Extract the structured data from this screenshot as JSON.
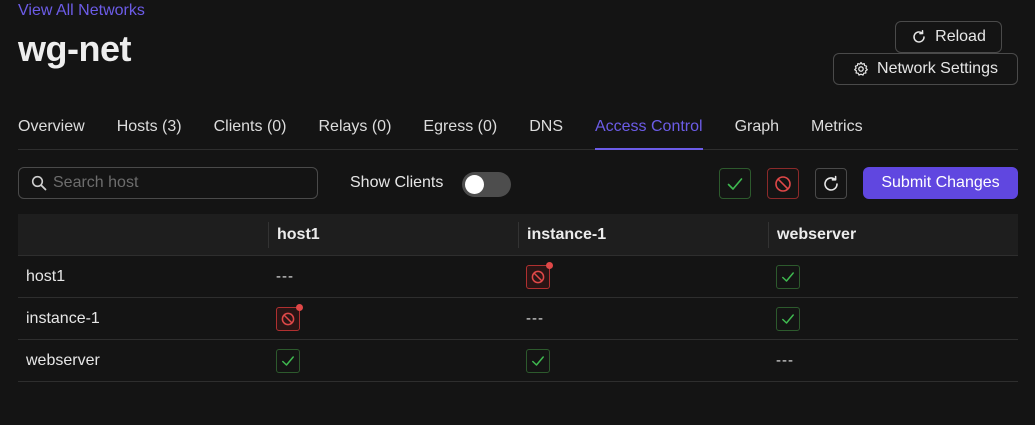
{
  "header": {
    "back_link": "View All Networks",
    "title": "wg-net",
    "reload_label": "Reload",
    "settings_label": "Network Settings"
  },
  "tabs": [
    {
      "label": "Overview"
    },
    {
      "label": "Hosts (3)"
    },
    {
      "label": "Clients (0)"
    },
    {
      "label": "Relays (0)"
    },
    {
      "label": "Egress (0)"
    },
    {
      "label": "DNS"
    },
    {
      "label": "Access Control",
      "active": true
    },
    {
      "label": "Graph"
    },
    {
      "label": "Metrics"
    }
  ],
  "toolbar": {
    "search_placeholder": "Search host",
    "search_value": "",
    "show_clients_label": "Show Clients",
    "show_clients_on": false,
    "submit_label": "Submit Changes"
  },
  "matrix": {
    "columns": [
      "host1",
      "instance-1",
      "webserver"
    ],
    "rows": [
      {
        "label": "host1",
        "cells": [
          "---",
          "deny-pending",
          "allow"
        ]
      },
      {
        "label": "instance-1",
        "cells": [
          "deny-pending",
          "---",
          "allow"
        ]
      },
      {
        "label": "webserver",
        "cells": [
          "allow",
          "allow",
          "---"
        ]
      }
    ]
  },
  "colors": {
    "accent": "#6047e0",
    "link": "#6c5ce7",
    "allow": "#3fb950",
    "deny": "#e04848"
  },
  "icons": {
    "reload": "reload-icon",
    "settings": "gear-icon",
    "search": "search-icon",
    "allow": "check-icon",
    "deny": "block-icon",
    "reset": "refresh-icon"
  }
}
